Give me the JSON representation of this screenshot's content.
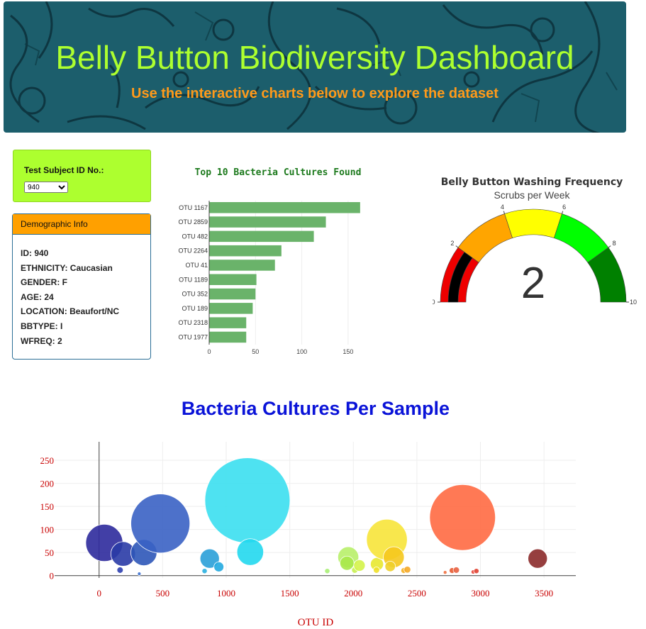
{
  "header": {
    "title": "Belly Button Biodiversity Dashboard",
    "subtitle": "Use the interactive charts below to explore the dataset"
  },
  "selector": {
    "label": "Test Subject ID No.:",
    "selected": "940"
  },
  "demographics": {
    "heading": "Demographic Info",
    "rows": [
      "ID: 940",
      "ETHNICITY: Caucasian",
      "GENDER: F",
      "AGE: 24",
      "LOCATION: Beaufort/NC",
      "BBTYPE: I",
      "WFREQ: 2"
    ]
  },
  "colors": {
    "bar": "#6ab36a",
    "banner": "#1c5e6c",
    "title_green": "#adff2f",
    "subtitle_orange": "#ff9a1a",
    "bubble_title": "#0a13d8",
    "axis_red": "#c80000"
  },
  "chart_data": [
    {
      "type": "bar",
      "orientation": "horizontal",
      "title": "Top 10 Bacteria Cultures Found",
      "categories": [
        "OTU 1167",
        "OTU 2859",
        "OTU 482",
        "OTU 2264",
        "OTU 41",
        "OTU 1189",
        "OTU 352",
        "OTU 189",
        "OTU 2318",
        "OTU 1977"
      ],
      "values": [
        163,
        126,
        113,
        78,
        71,
        51,
        50,
        47,
        40,
        40
      ],
      "xlim": [
        0,
        170
      ],
      "xticks": [
        0,
        50,
        100,
        150
      ]
    },
    {
      "type": "gauge",
      "title": "Belly Button Washing Frequency",
      "subtitle": "Scrubs per Week",
      "value": 2,
      "range": [
        0,
        10
      ],
      "ticks": [
        0,
        2,
        4,
        6,
        8,
        10
      ],
      "bands": [
        {
          "from": 0,
          "to": 2,
          "color": "#ee0000"
        },
        {
          "from": 2,
          "to": 4,
          "color": "#ffa500"
        },
        {
          "from": 4,
          "to": 6,
          "color": "#ffff00"
        },
        {
          "from": 6,
          "to": 8,
          "color": "#00ff00"
        },
        {
          "from": 8,
          "to": 10,
          "color": "#008000"
        }
      ]
    },
    {
      "type": "scatter",
      "title": "Bacteria Cultures Per Sample",
      "xlabel": "OTU ID",
      "xlim": [
        -350,
        3750
      ],
      "ylim": [
        -5,
        290
      ],
      "xticks": [
        0,
        500,
        1000,
        1500,
        2000,
        2500,
        3000,
        3500
      ],
      "yticks": [
        0,
        50,
        100,
        150,
        200,
        250
      ],
      "points": [
        {
          "x": 41,
          "y": 71,
          "color": "#2d2a9c"
        },
        {
          "x": 189,
          "y": 47,
          "color": "#2a3ba6"
        },
        {
          "x": 165,
          "y": 12,
          "color": "#2d3fb0"
        },
        {
          "x": 352,
          "y": 50,
          "color": "#2d56b8"
        },
        {
          "x": 482,
          "y": 113,
          "color": "#3a62c4"
        },
        {
          "x": 316,
          "y": 4,
          "color": "#3b6fcf"
        },
        {
          "x": 870,
          "y": 37,
          "color": "#2aa0d8"
        },
        {
          "x": 942,
          "y": 19,
          "color": "#22aae0"
        },
        {
          "x": 830,
          "y": 10,
          "color": "#2ab0e0"
        },
        {
          "x": 1167,
          "y": 163,
          "color": "#3bdff0"
        },
        {
          "x": 1189,
          "y": 51,
          "color": "#22d8ee"
        },
        {
          "x": 1795,
          "y": 10,
          "color": "#a8f074"
        },
        {
          "x": 1960,
          "y": 40,
          "color": "#b8ef6a"
        },
        {
          "x": 1950,
          "y": 27,
          "color": "#a8e84a"
        },
        {
          "x": 2011,
          "y": 12,
          "color": "#c8f050"
        },
        {
          "x": 2048,
          "y": 22,
          "color": "#d4f34a"
        },
        {
          "x": 2186,
          "y": 25,
          "color": "#e8e830"
        },
        {
          "x": 2264,
          "y": 78,
          "color": "#f7e43a"
        },
        {
          "x": 2182,
          "y": 12,
          "color": "#f0e02a"
        },
        {
          "x": 2318,
          "y": 40,
          "color": "#f5c81e"
        },
        {
          "x": 2290,
          "y": 20,
          "color": "#f0d02a"
        },
        {
          "x": 2397,
          "y": 11,
          "color": "#f5b020"
        },
        {
          "x": 2425,
          "y": 13,
          "color": "#f5a828"
        },
        {
          "x": 2722,
          "y": 7,
          "color": "#f07040"
        },
        {
          "x": 2777,
          "y": 11,
          "color": "#e85a30"
        },
        {
          "x": 2810,
          "y": 12,
          "color": "#e86040"
        },
        {
          "x": 2859,
          "y": 126,
          "color": "#ff6a42"
        },
        {
          "x": 2943,
          "y": 8,
          "color": "#e8463a"
        },
        {
          "x": 2968,
          "y": 10,
          "color": "#e04030"
        },
        {
          "x": 3450,
          "y": 37,
          "color": "#8b2a2a"
        }
      ]
    }
  ]
}
